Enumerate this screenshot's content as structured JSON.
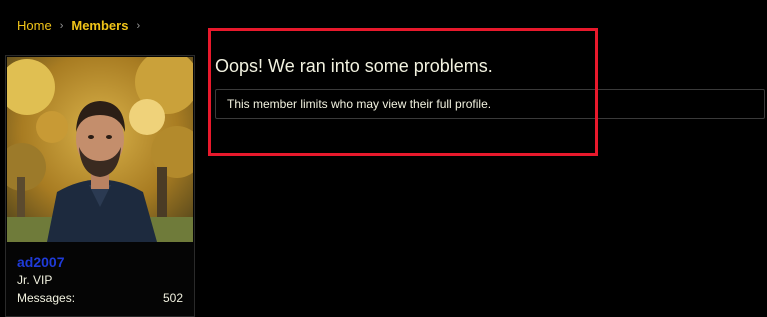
{
  "breadcrumb": {
    "home": "Home",
    "members": "Members",
    "separator": "›"
  },
  "profile": {
    "username": "ad2007",
    "title": "Jr. VIP",
    "stats": [
      {
        "label": "Messages:",
        "value": "502"
      }
    ]
  },
  "error": {
    "title": "Oops! We ran into some problems.",
    "message": "This member limits who may view their full profile."
  },
  "colors": {
    "accent": "#f0c419",
    "username": "#1f3bd9",
    "highlight": "#e8192c",
    "background": "#000000"
  }
}
